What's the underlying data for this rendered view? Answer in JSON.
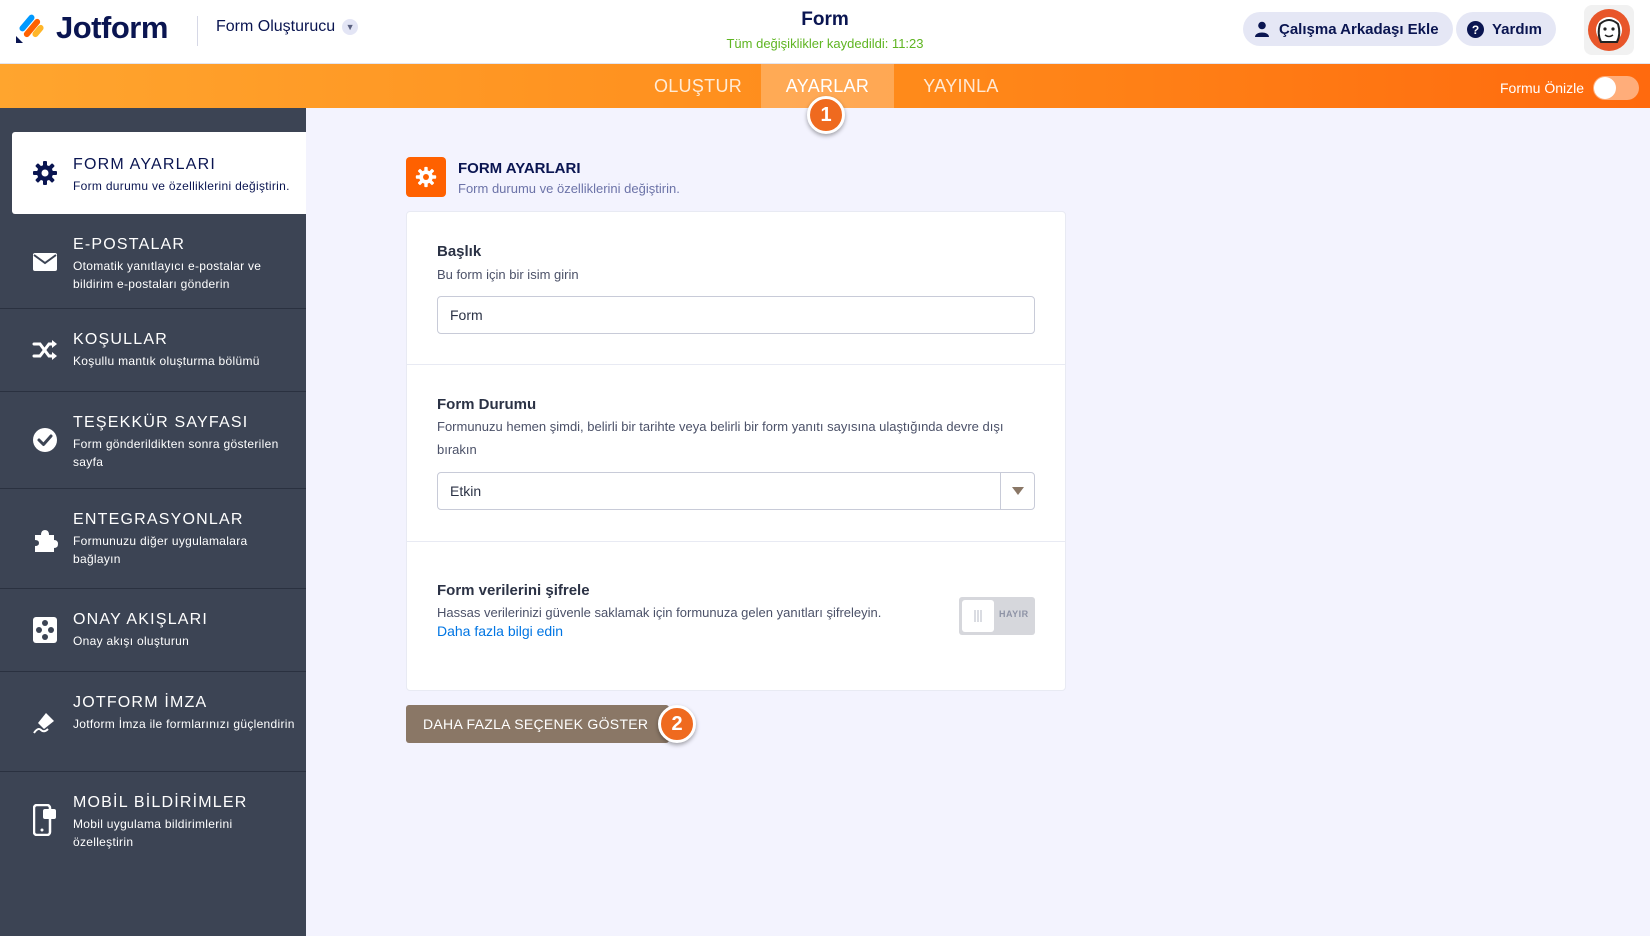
{
  "app": {
    "logo_text": "Jotform",
    "builder_label": "Form Oluşturucu",
    "form_title": "Form",
    "save_status": "Tüm değişiklikler kaydedildi: 11:23",
    "invite_label": "Çalışma Arkadaşı Ekle",
    "help_label": "Yardım"
  },
  "nav": {
    "tabs": [
      {
        "label": "OLUŞTUR"
      },
      {
        "label": "AYARLAR"
      },
      {
        "label": "YAYINLA"
      }
    ],
    "preview_label": "Formu Önizle"
  },
  "badges": {
    "one": "1",
    "two": "2"
  },
  "sidebar": {
    "items": [
      {
        "title": "FORM AYARLARI",
        "desc": "Form durumu ve özelliklerini değiştirin."
      },
      {
        "title": "E-POSTALAR",
        "desc": "Otomatik yanıtlayıcı e-postalar ve bildirim e-postaları gönderin"
      },
      {
        "title": "KOŞULLAR",
        "desc": "Koşullu mantık oluşturma bölümü"
      },
      {
        "title": "TEŞEKKÜR SAYFASI",
        "desc": "Form gönderildikten sonra gösterilen sayfa"
      },
      {
        "title": "ENTEGRASYONLAR",
        "desc": "Formunuzu diğer uygulamalara bağlayın"
      },
      {
        "title": "ONAY AKIŞLARI",
        "desc": "Onay akışı oluşturun"
      },
      {
        "title": "JOTFORM İMZA",
        "desc": "Jotform İmza ile formlarınızı güçlendirin"
      },
      {
        "title": "MOBİL BİLDİRİMLER",
        "desc": "Mobil uygulama bildirimlerini özelleştirin"
      }
    ]
  },
  "section": {
    "title": "FORM AYARLARI",
    "subtitle": "Form durumu ve özelliklerini değiştirin."
  },
  "fields": {
    "title_label": "Başlık",
    "title_desc": "Bu form için bir isim girin",
    "title_value": "Form",
    "status_label": "Form Durumu",
    "status_desc": "Formunuzu hemen şimdi, belirli bir tarihte veya belirli bir form yanıtı sayısına ulaştığında devre dışı bırakın",
    "status_value": "Etkin",
    "encrypt_label": "Form verilerini şifrele",
    "encrypt_desc": "Hassas verilerinizi güvenle saklamak için formunuza gelen yanıtları şifreleyin.",
    "encrypt_link": "Daha fazla bilgi edin",
    "encrypt_toggle": "HAYIR"
  },
  "more_button": "DAHA FAZLA SEÇENEK GÖSTER"
}
